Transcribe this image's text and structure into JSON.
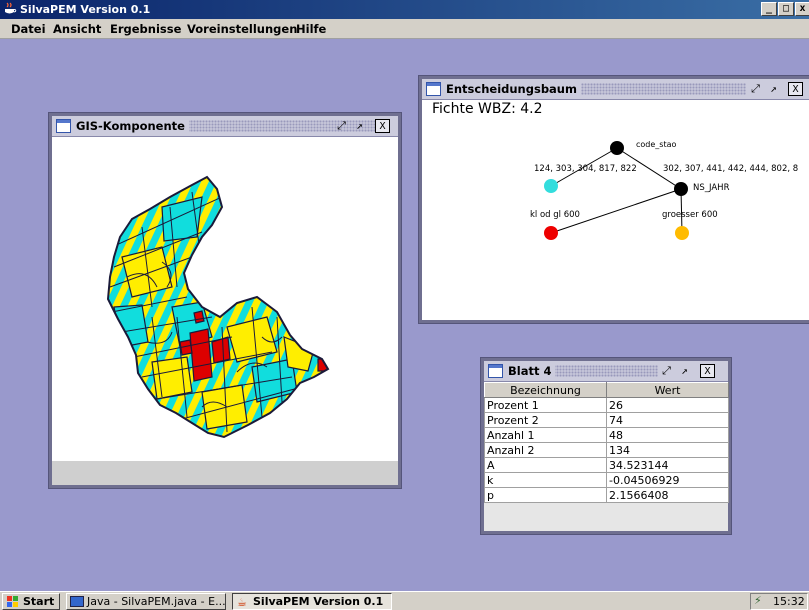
{
  "window": {
    "title": "SilvaPEM Version 0.1",
    "controls": [
      "_",
      "□",
      "x"
    ]
  },
  "menu": [
    "Datei",
    "Ansicht",
    "Ergebnisse",
    "Voreinstellungen",
    "Hilfe"
  ],
  "gis": {
    "title": "GIS-Komponente",
    "colors": {
      "yellow": "#ffee00",
      "cyan": "#11dddd",
      "red": "#dd0000",
      "outline": "#1a1a3a"
    }
  },
  "tree": {
    "title": "Entscheidungsbaum",
    "heading": "Fichte WBZ: 4.2",
    "nodes": {
      "root": "code_stao",
      "left_edge": "124, 303, 304, 817, 822",
      "right_edge": "302, 307, 441, 442, 444, 802, 8",
      "inner": "NS_JAHR",
      "leaf_left": "kl od gl 600",
      "leaf_right": "groesser 600"
    },
    "colors": {
      "cyan": "#33dddd",
      "red": "#ee0000",
      "orange": "#ffbb00",
      "black": "#000000"
    }
  },
  "blatt": {
    "title": "Blatt 4",
    "columns": [
      "Bezeichnung",
      "Wert"
    ],
    "rows": [
      [
        "Prozent 1",
        "26"
      ],
      [
        "Prozent 2",
        "74"
      ],
      [
        "Anzahl 1",
        "48"
      ],
      [
        "Anzahl 2",
        "134"
      ],
      [
        "A",
        "34.523144"
      ],
      [
        "k",
        "-0.04506929"
      ],
      [
        "p",
        "2.1566408"
      ]
    ]
  },
  "frame_controls": {
    "iconify": "⤢",
    "maximize": "↗",
    "close": "X"
  },
  "taskbar": {
    "start": "Start",
    "tasks": [
      "Java - SilvaPEM.java - E...",
      "SilvaPEM Version 0.1"
    ],
    "clock": "15:32"
  }
}
